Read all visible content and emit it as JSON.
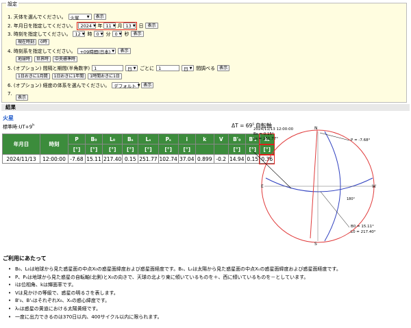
{
  "settings": {
    "legend": "設定",
    "row1": {
      "label": "1. 天体を選んでください。",
      "planet": "火星",
      "button": "表示"
    },
    "row2": {
      "label": "2. 年月日を指定してください。",
      "year": "2024",
      "year_unit": "年",
      "month": "11",
      "month_unit": "月",
      "day": "13",
      "day_unit": "日",
      "button": "表示"
    },
    "row3": {
      "label": "3. 時刻を指定してください。",
      "hour": "12",
      "hour_unit": "時",
      "minute": "0",
      "minute_unit": "分",
      "second": "0",
      "second_unit": "秒",
      "button": "表示",
      "now_button": "現在時刻",
      "zero_button": "0時"
    },
    "row4": {
      "label": "4. 時刻系を指定してください。",
      "timezone": "+09時間(日本)",
      "button": "表示",
      "b1": "地球時",
      "b2": "世界時",
      "b3": "中央標準時"
    },
    "row5": {
      "label": "5. (オプション) 間隔と期間(半角数字)",
      "interval": "1",
      "unit": "日",
      "mid": "ごとに",
      "count": "1",
      "unit2": "日",
      "tail": "間調べる",
      "button": "表示",
      "b1": "1日おきに1月間",
      "b2": "1日おきに1年間",
      "b3": "1時間おきに1日"
    },
    "row6": {
      "label": "6. (オプション) 経度の体系を選んでください。",
      "system": "デフォルト",
      "button": "表示"
    },
    "row7": {
      "label": "7.",
      "button": "表示"
    }
  },
  "result": {
    "header": "結果",
    "planet": "火星",
    "standard_time": "標準時:UT+9",
    "standard_time_sup": "h",
    "delta_t": "ΔT = 69",
    "delta_t_sup": "s",
    "rotation_axis": "自転軸"
  },
  "table": {
    "headers": [
      "年月日",
      "時刻",
      "P",
      "B₀",
      "L₀",
      "Bₛ",
      "Lₛ",
      "Pₛ",
      "i",
      "k",
      "V",
      "B'₀",
      "B'ₛ",
      "λₛ"
    ],
    "units": [
      "",
      "",
      "[°]",
      "[°]",
      "[°]",
      "[°]",
      "[°]",
      "[°]",
      "[°]",
      "",
      "",
      "[°]",
      "[°]",
      "[°]"
    ],
    "row": [
      "2024/11/13",
      "12:00:00",
      "-7.68",
      "15.11",
      "217.40",
      "0.15",
      "251.77",
      "102.74",
      "37.04",
      "0.899",
      "-0.2",
      "14.94",
      "0.15",
      "0.36"
    ]
  },
  "diagram": {
    "datetime": "2024/11/13 12:00:00",
    "bs": "Bs = 0.15°",
    "ls": "Ls = 251.77°",
    "p": "P = -7.68°",
    "b0": "B0 = 15.11°",
    "l0": "L0 = 217.40°",
    "n": "N",
    "s": "S",
    "e": "E",
    "w": "W",
    "meridian": "180°"
  },
  "notes": {
    "title": "ご利用にあたって",
    "items": [
      "B₀、L₀は地球から見た惑星面の中点X₀の惑星面緯度および惑星面経度です。Bₛ、Lₛは太陽から見た惑星面の中点Xₛの惑星面緯度および惑星面経度です。",
      "P、Pₛは地球から見た惑星の自転軸(北側)とX₀の向きで、天球の北より東に傾いているものを＋、西に傾いているものを－としています。",
      "iは位相角、kは輝面率です。",
      "Vは見かけの等級で、惑星の明るさを表します。",
      "B'₀、B'ₛはそれぞれX₀、Xₛの惑心緯度です。",
      "λₛは惑星の黄道における太陽黄経です。",
      "一度に出力できるのは370日以内、400サイクル以内に限られます。"
    ]
  }
}
